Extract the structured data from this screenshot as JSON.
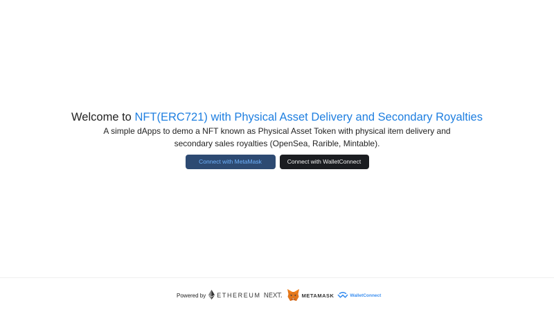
{
  "hero": {
    "welcome_prefix": "Welcome to ",
    "title_link": "NFT(ERC721) with Physical Asset Delivery and Secondary Royalties",
    "description": "A simple dApps to demo a NFT known as Physical Asset Token with physical item delivery and secondary sales royalties (OpenSea, Rarible, Mintable)."
  },
  "buttons": {
    "metamask_label": "Connect with MetaMask",
    "walletconnect_label": "Connect with WalletConnect"
  },
  "footer": {
    "powered_by": "Powered by",
    "ethereum": "ETHEREUM",
    "next": "NEXT.",
    "metamask": "METAMASK",
    "walletconnect": "WalletConnect"
  },
  "colors": {
    "link": "#1f7fe0",
    "metamask_button_bg": "#2d4a72",
    "metamask_button_text": "#6fb3ff",
    "walletconnect_button_bg": "#1b1d21",
    "walletconnect_brand": "#3b8ff0",
    "metamask_fox": "#e2761b"
  },
  "icons": [
    "ethereum-icon",
    "metamask-fox-icon",
    "walletconnect-icon"
  ]
}
